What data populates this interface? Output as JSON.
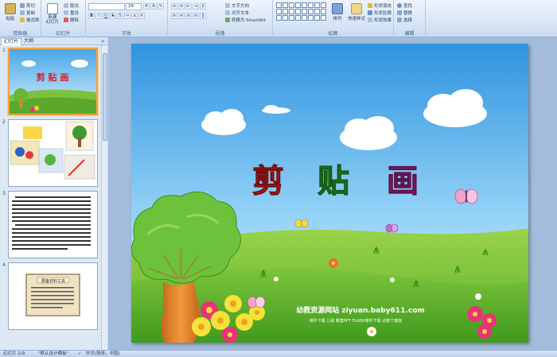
{
  "ribbon": {
    "clipboard": {
      "paste": "粘贴",
      "cut": "剪切",
      "copy": "复制",
      "format_painter": "格式刷",
      "label": "剪贴板"
    },
    "slides": {
      "new_slide": "新建\n幻灯片",
      "layout": "版式",
      "reset": "重设",
      "delete": "删除",
      "label": "幻灯片"
    },
    "font": {
      "font_name": "",
      "font_size": "24",
      "label": "字体"
    },
    "paragraph": {
      "text_direction": "文字方向",
      "align_text": "对齐文本",
      "smartart": "转换为 SmartArt",
      "label": "段落"
    },
    "drawing": {
      "arrange": "排列",
      "quick_styles": "快速样式",
      "shape_fill": "形状填充",
      "shape_outline": "形状轮廓",
      "shape_effects": "形状效果",
      "label": "绘图"
    },
    "editing": {
      "find": "查找",
      "replace": "替换",
      "select": "选择",
      "label": "编辑"
    }
  },
  "pane": {
    "tab_slides": "幻灯片",
    "tab_outline": "大纲",
    "close": "×",
    "thumbs": [
      {
        "num": "1"
      },
      {
        "num": "2"
      },
      {
        "num": "3"
      },
      {
        "num": "4"
      }
    ],
    "thumb1_title": "剪 贴 画",
    "thumb4_title": "要备材料工具"
  },
  "slide": {
    "title_chars": [
      "剪",
      "贴",
      "画"
    ],
    "title_colors": [
      "#e8202a",
      "#2f9a2a",
      "#a0287c"
    ],
    "watermark_main": "幼教资源网站  ziyuan.baby611.com",
    "watermark_sub": "课件下载  儿歌  教案PPT  FLASH课件下载  试卷下载库"
  },
  "status": {
    "slide_info": "幻灯片 1/9",
    "theme": "\"默认设计模板\"",
    "language": "中文(简体，中国)"
  }
}
